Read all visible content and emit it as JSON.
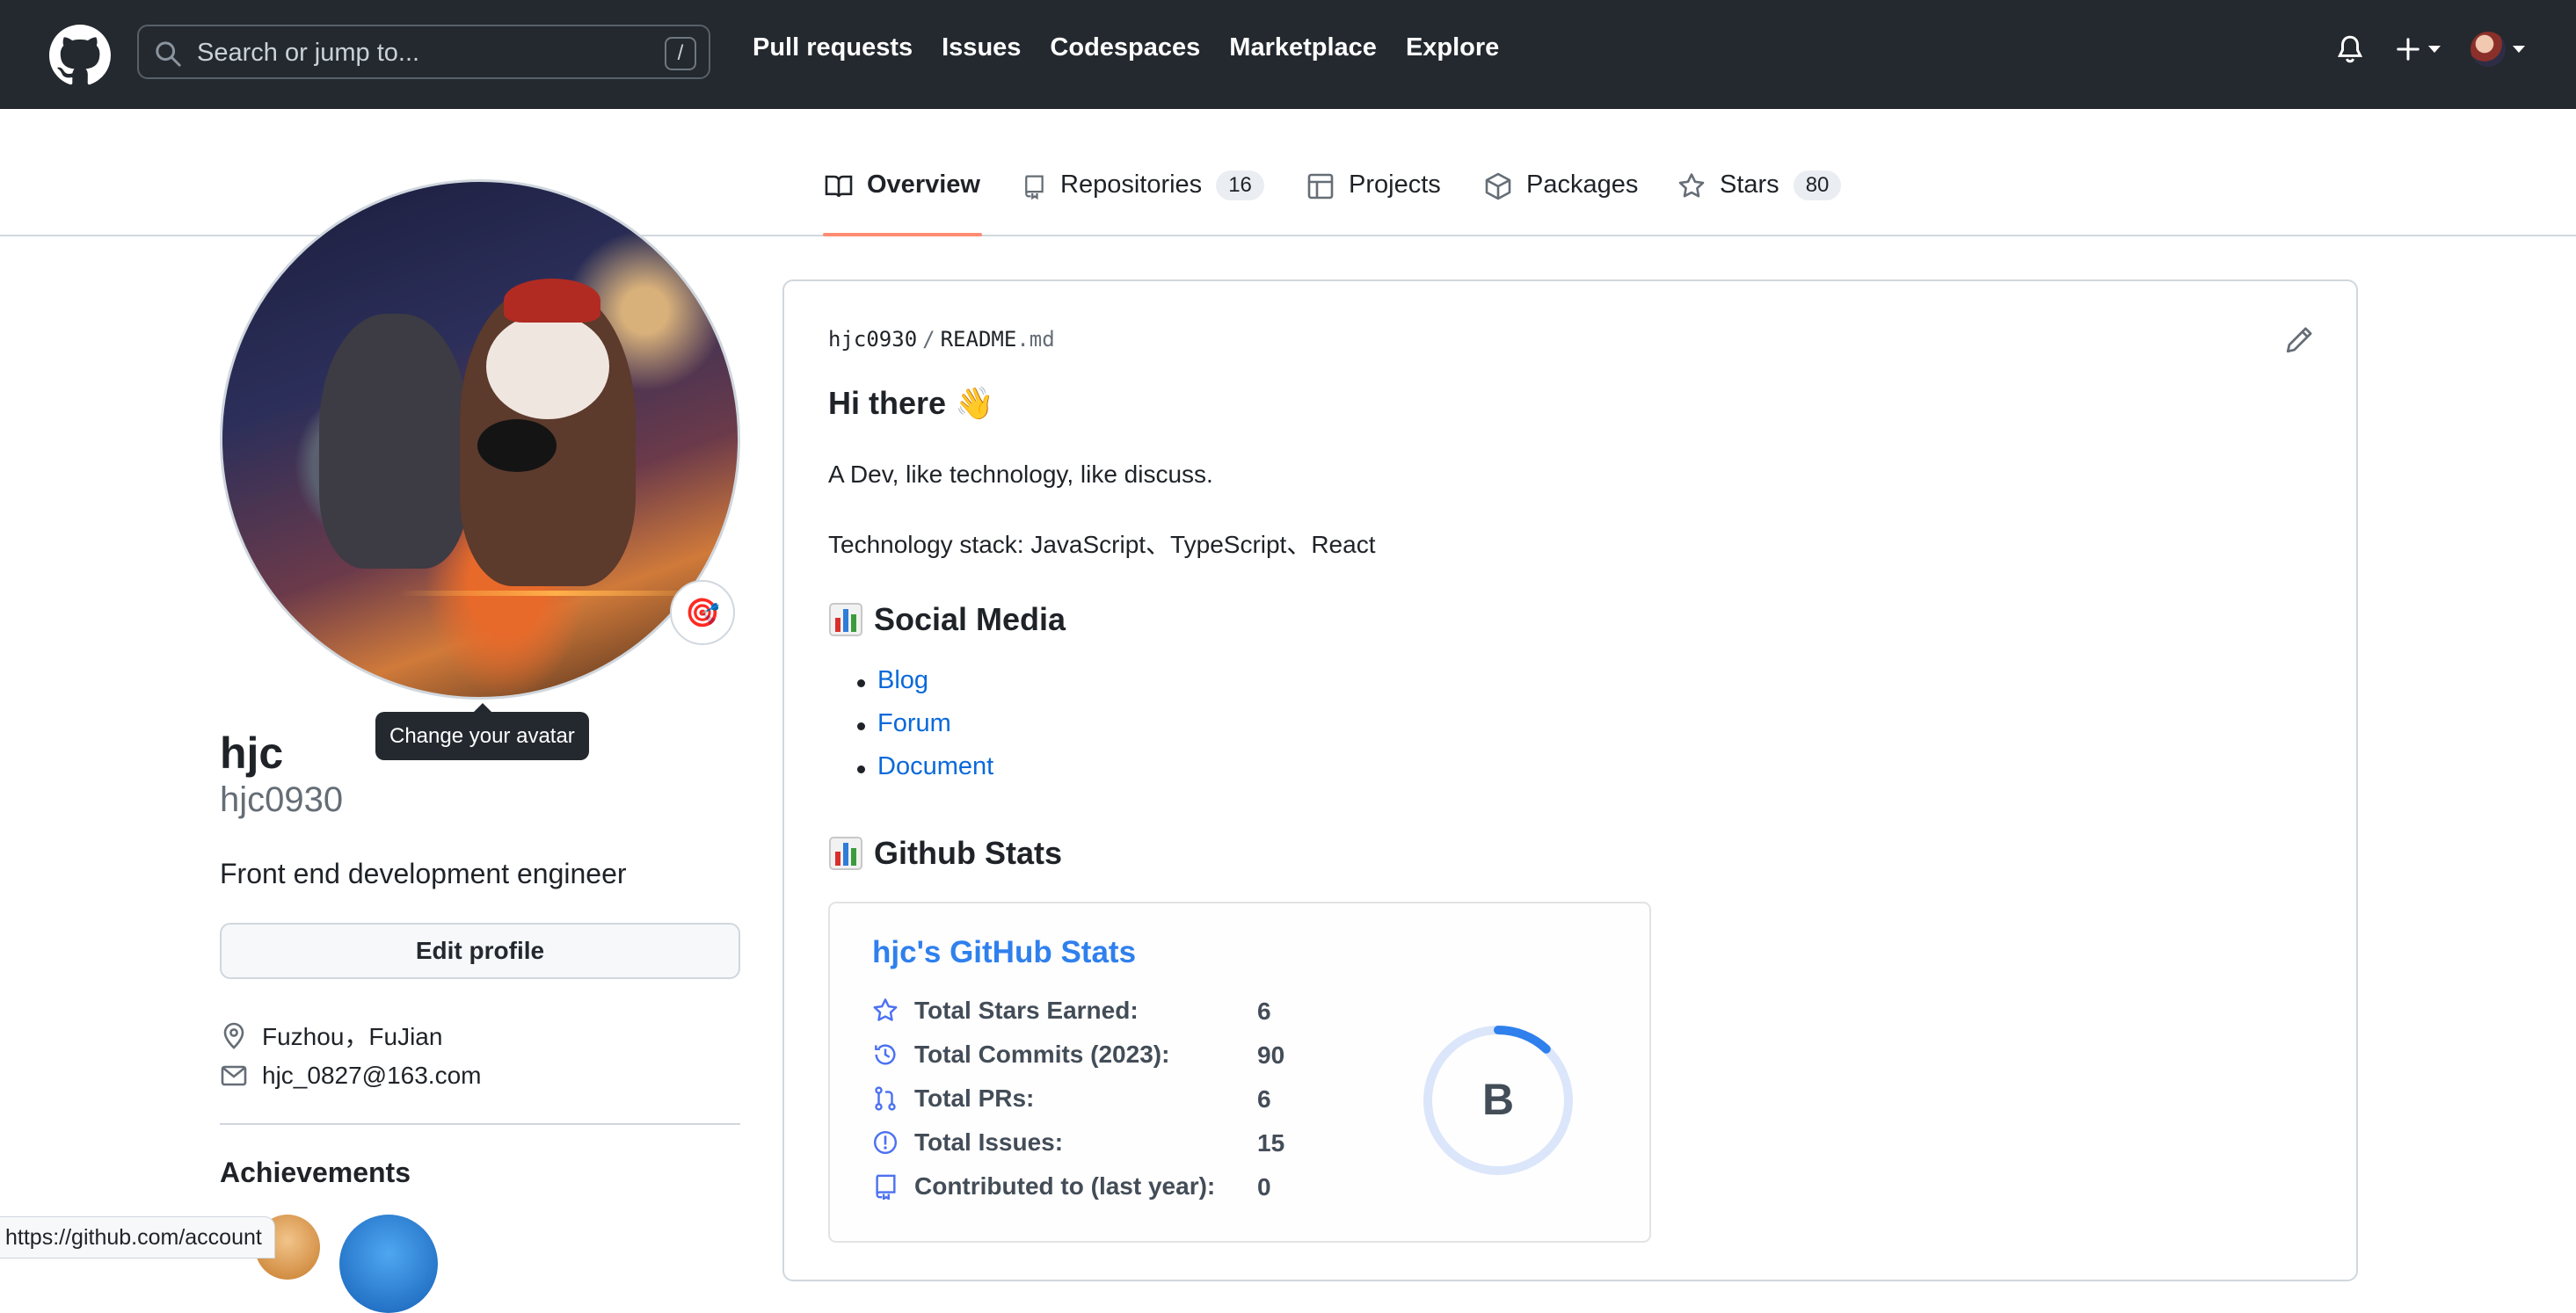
{
  "header": {
    "search_placeholder": "Search or jump to...",
    "search_shortcut": "/",
    "nav": [
      "Pull requests",
      "Issues",
      "Codespaces",
      "Marketplace",
      "Explore"
    ]
  },
  "tabs": [
    {
      "label": "Overview",
      "count": null,
      "active": true
    },
    {
      "label": "Repositories",
      "count": "16"
    },
    {
      "label": "Projects",
      "count": null
    },
    {
      "label": "Packages",
      "count": null
    },
    {
      "label": "Stars",
      "count": "80"
    }
  ],
  "profile": {
    "avatar_tooltip": "Change your avatar",
    "status_emoji": "🎯",
    "name": "hjc",
    "login": "hjc0930",
    "bio": "Front end development engineer",
    "edit_button": "Edit profile",
    "location": "Fuzhou，FuJian",
    "email": "hjc_0827@163.com",
    "achievements_title": "Achievements"
  },
  "readme": {
    "owner": "hjc0930",
    "separator": "/",
    "filename": "README",
    "extension": ".md",
    "heading": "Hi there",
    "heading_emoji": "👋",
    "line1": "A Dev, like technology, like discuss.",
    "line2": "Technology stack: JavaScript、TypeScript、React",
    "social_title": "Social Media",
    "social_links": [
      "Blog",
      "Forum",
      "Document"
    ],
    "stats_title": "Github Stats"
  },
  "stats_card": {
    "title": "hjc's GitHub Stats",
    "rows": [
      {
        "label": "Total Stars Earned:",
        "value": "6",
        "icon": "star-icon"
      },
      {
        "label": "Total Commits (2023):",
        "value": "90",
        "icon": "history-icon"
      },
      {
        "label": "Total PRs:",
        "value": "6",
        "icon": "pull-request-icon"
      },
      {
        "label": "Total Issues:",
        "value": "15",
        "icon": "issue-icon"
      },
      {
        "label": "Contributed to (last year):",
        "value": "0",
        "icon": "repo-icon"
      }
    ],
    "rank": "B",
    "rank_progress": 0.12,
    "accent": "#2f80ed"
  },
  "status_bar_url": "https://github.com/account"
}
